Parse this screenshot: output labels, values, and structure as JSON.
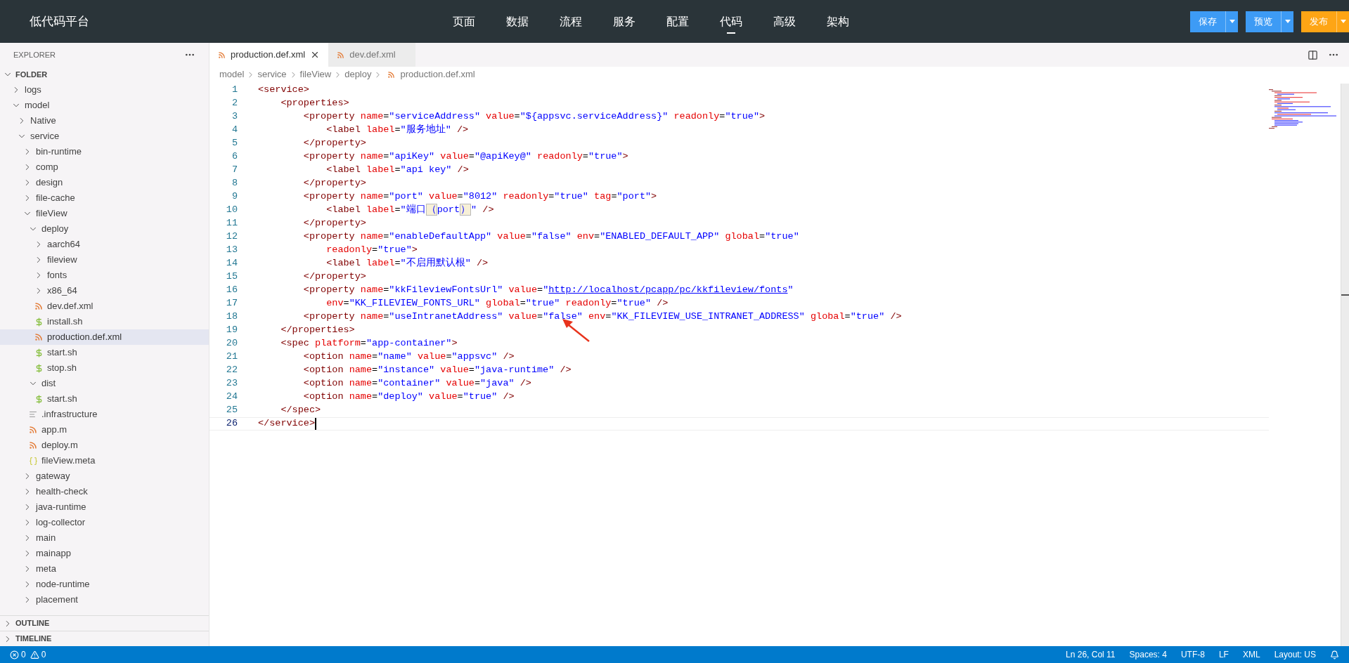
{
  "app": {
    "title": "低代码平台"
  },
  "nav": [
    {
      "label": "页面",
      "selected": false
    },
    {
      "label": "数据",
      "selected": false
    },
    {
      "label": "流程",
      "selected": false
    },
    {
      "label": "服务",
      "selected": false
    },
    {
      "label": "配置",
      "selected": false
    },
    {
      "label": "代码",
      "selected": true
    },
    {
      "label": "高级",
      "selected": false
    },
    {
      "label": "架构",
      "selected": false
    }
  ],
  "actions": [
    {
      "label": "保存",
      "kind": "primary"
    },
    {
      "label": "预览",
      "kind": "primary"
    },
    {
      "label": "发布",
      "kind": "accent"
    }
  ],
  "sidebar": {
    "title": "EXPLORER",
    "folder": {
      "label": "FOLDER",
      "expanded": true,
      "children": [
        {
          "label": "logs",
          "kind": "folder",
          "expanded": false,
          "selected": false
        },
        {
          "label": "model",
          "kind": "folder",
          "expanded": true,
          "selected": false,
          "children": [
            {
              "label": "Native",
              "kind": "folder",
              "expanded": false,
              "selected": false
            },
            {
              "label": "service",
              "kind": "folder",
              "expanded": true,
              "selected": false,
              "children": [
                {
                  "label": "bin-runtime",
                  "kind": "folder",
                  "expanded": false,
                  "selected": false
                },
                {
                  "label": "comp",
                  "kind": "folder",
                  "expanded": false,
                  "selected": false
                },
                {
                  "label": "design",
                  "kind": "folder",
                  "expanded": false,
                  "selected": false
                },
                {
                  "label": "file-cache",
                  "kind": "folder",
                  "expanded": false,
                  "selected": false
                },
                {
                  "label": "fileView",
                  "kind": "folder",
                  "expanded": true,
                  "selected": false,
                  "children": [
                    {
                      "label": "deploy",
                      "kind": "folder",
                      "expanded": true,
                      "selected": false,
                      "children": [
                        {
                          "label": "aarch64",
                          "kind": "folder",
                          "expanded": false,
                          "selected": false
                        },
                        {
                          "label": "fileview",
                          "kind": "folder",
                          "expanded": false,
                          "selected": false
                        },
                        {
                          "label": "fonts",
                          "kind": "folder",
                          "expanded": false,
                          "selected": false
                        },
                        {
                          "label": "x86_64",
                          "kind": "folder",
                          "expanded": false,
                          "selected": false
                        },
                        {
                          "label": "dev.def.xml",
                          "kind": "xml",
                          "selected": false
                        },
                        {
                          "label": "install.sh",
                          "kind": "sh",
                          "selected": false
                        },
                        {
                          "label": "production.def.xml",
                          "kind": "xml",
                          "selected": true
                        },
                        {
                          "label": "start.sh",
                          "kind": "sh",
                          "selected": false
                        },
                        {
                          "label": "stop.sh",
                          "kind": "sh",
                          "selected": false
                        }
                      ]
                    },
                    {
                      "label": "dist",
                      "kind": "folder",
                      "expanded": true,
                      "selected": false,
                      "children": [
                        {
                          "label": "start.sh",
                          "kind": "sh",
                          "selected": false
                        }
                      ]
                    },
                    {
                      "label": ".infrastructure",
                      "kind": "text",
                      "selected": false
                    },
                    {
                      "label": "app.m",
                      "kind": "xml",
                      "selected": false
                    },
                    {
                      "label": "deploy.m",
                      "kind": "xml",
                      "selected": false
                    },
                    {
                      "label": "fileView.meta",
                      "kind": "json",
                      "selected": false
                    }
                  ]
                },
                {
                  "label": "gateway",
                  "kind": "folder",
                  "expanded": false,
                  "selected": false
                },
                {
                  "label": "health-check",
                  "kind": "folder",
                  "expanded": false,
                  "selected": false
                },
                {
                  "label": "java-runtime",
                  "kind": "folder",
                  "expanded": false,
                  "selected": false
                },
                {
                  "label": "log-collector",
                  "kind": "folder",
                  "expanded": false,
                  "selected": false
                },
                {
                  "label": "main",
                  "kind": "folder",
                  "expanded": false,
                  "selected": false
                },
                {
                  "label": "mainapp",
                  "kind": "folder",
                  "expanded": false,
                  "selected": false
                },
                {
                  "label": "meta",
                  "kind": "folder",
                  "expanded": false,
                  "selected": false
                },
                {
                  "label": "node-runtime",
                  "kind": "folder",
                  "expanded": false,
                  "selected": false
                },
                {
                  "label": "placement",
                  "kind": "folder",
                  "expanded": false,
                  "selected": false
                }
              ]
            }
          ]
        }
      ]
    },
    "panels": [
      {
        "label": "OUTLINE",
        "expanded": false
      },
      {
        "label": "TIMELINE",
        "expanded": false
      }
    ]
  },
  "editor": {
    "tabs": [
      {
        "label": "production.def.xml",
        "selected": true
      },
      {
        "label": "dev.def.xml",
        "selected": false
      }
    ],
    "breadcrumbs": [
      "model",
      "service",
      "fileView",
      "deploy",
      "production.def.xml"
    ],
    "lines": [
      {
        "number": "1",
        "current": false,
        "code": [
          {
            "kind": "code",
            "text": "<service>"
          }
        ]
      },
      {
        "number": "2",
        "current": false,
        "code": [
          {
            "kind": "code",
            "text": "    <properties>"
          }
        ]
      },
      {
        "number": "3",
        "current": false,
        "code": [
          {
            "kind": "code",
            "text": "        <property name=\"serviceAddress\" value=\"${appsvc.serviceAddress}\" readonly=\"true\">"
          }
        ]
      },
      {
        "number": "4",
        "current": false,
        "code": [
          {
            "kind": "code",
            "text": "            <label label=\"服务地址\" />"
          }
        ]
      },
      {
        "number": "5",
        "current": false,
        "code": [
          {
            "kind": "code",
            "text": "        </property>"
          }
        ]
      },
      {
        "number": "6",
        "current": false,
        "code": [
          {
            "kind": "code",
            "text": "        <property name=\"apiKey\" value=\"@apiKey@\" readonly=\"true\">"
          }
        ]
      },
      {
        "number": "7",
        "current": false,
        "code": [
          {
            "kind": "code",
            "text": "            <label label=\"api key\" />"
          }
        ]
      },
      {
        "number": "8",
        "current": false,
        "code": [
          {
            "kind": "code",
            "text": "        </property>"
          }
        ]
      },
      {
        "number": "9",
        "current": false,
        "code": [
          {
            "kind": "code",
            "text": "        <property name=\"port\" value=\"8012\" readonly=\"true\" tag=\"port\">"
          }
        ]
      },
      {
        "number": "10",
        "current": false,
        "code": [
          {
            "kind": "code",
            "text": "            <label label=\"端口"
          },
          {
            "kind": "bracket",
            "text": "（"
          },
          {
            "kind": "code",
            "text": "port"
          },
          {
            "kind": "bracket",
            "text": "）"
          },
          {
            "kind": "code",
            "text": "\" />"
          }
        ]
      },
      {
        "number": "11",
        "current": false,
        "code": [
          {
            "kind": "code",
            "text": "        </property>"
          }
        ]
      },
      {
        "number": "12",
        "current": false,
        "code": [
          {
            "kind": "code",
            "text": "        <property name=\"enableDefaultApp\" value=\"false\" env=\"ENABLED_DEFAULT_APP\" global=\"true\""
          }
        ]
      },
      {
        "number": "13",
        "current": false,
        "code": [
          {
            "kind": "code",
            "text": "            readonly=\"true\">"
          }
        ]
      },
      {
        "number": "14",
        "current": false,
        "code": [
          {
            "kind": "code",
            "text": "            <label label=\"不启用默认根\" />"
          }
        ]
      },
      {
        "number": "15",
        "current": false,
        "code": [
          {
            "kind": "code",
            "text": "        </property>"
          }
        ]
      },
      {
        "number": "16",
        "current": false,
        "code": [
          {
            "kind": "code",
            "text": "        <property name=\"kkFileviewFontsUrl\" value=\""
          },
          {
            "kind": "link",
            "text": "http://localhost/pcapp/pc/kkfileview/fonts"
          },
          {
            "kind": "code",
            "text": "\""
          }
        ]
      },
      {
        "number": "17",
        "current": false,
        "code": [
          {
            "kind": "code",
            "text": "            env=\"KK_FILEVIEW_FONTS_URL\" global=\"true\" readonly=\"true\" />"
          }
        ]
      },
      {
        "number": "18",
        "current": false,
        "code": [
          {
            "kind": "code",
            "text": "        <property name=\"useIntranetAddress\" value=\"false\" env=\"KK_FILEVIEW_USE_INTRANET_ADDRESS\" global=\"true\" />"
          }
        ]
      },
      {
        "number": "19",
        "current": false,
        "code": [
          {
            "kind": "code",
            "text": "    </properties>"
          }
        ]
      },
      {
        "number": "20",
        "current": false,
        "code": [
          {
            "kind": "code",
            "text": "    <spec platform=\"app-container\">"
          }
        ]
      },
      {
        "number": "21",
        "current": false,
        "code": [
          {
            "kind": "code",
            "text": "        <option name=\"name\" value=\"appsvc\" />"
          }
        ]
      },
      {
        "number": "22",
        "current": false,
        "code": [
          {
            "kind": "code",
            "text": "        <option name=\"instance\" value=\"java-runtime\" />"
          }
        ]
      },
      {
        "number": "23",
        "current": false,
        "code": [
          {
            "kind": "code",
            "text": "        <option name=\"container\" value=\"java\" />"
          }
        ]
      },
      {
        "number": "24",
        "current": false,
        "code": [
          {
            "kind": "code",
            "text": "        <option name=\"deploy\" value=\"true\" />"
          }
        ]
      },
      {
        "number": "25",
        "current": false,
        "code": [
          {
            "kind": "code",
            "text": "    </spec>"
          }
        ]
      },
      {
        "number": "26",
        "current": true,
        "code": [
          {
            "kind": "code",
            "text": "</service>"
          }
        ]
      }
    ]
  },
  "status_bar": {
    "errors": "0",
    "warnings": "0",
    "items": [
      "Ln 26, Col 11",
      "Spaces: 4",
      "UTF-8",
      "LF",
      "XML",
      "Layout: US"
    ]
  }
}
